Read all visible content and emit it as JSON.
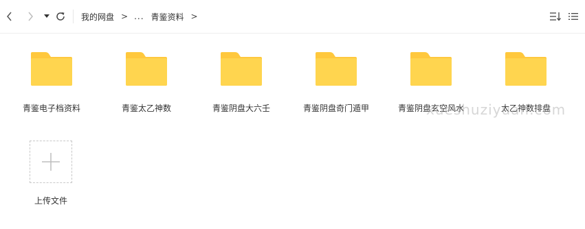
{
  "toolbar": {
    "breadcrumb": {
      "root": "我的网盘",
      "separator": ">",
      "ellipsis": "...",
      "current": "青鉴资料",
      "trailing_separator": ">"
    },
    "icons": {
      "back": "chevron-left-icon",
      "forward": "chevron-right-icon",
      "history": "caret-down-icon",
      "refresh": "refresh-icon",
      "sort": "sort-icon",
      "view": "list-view-icon"
    }
  },
  "files": [
    {
      "name": "青鉴电子档资料",
      "type": "folder"
    },
    {
      "name": "青鉴太乙神数",
      "type": "folder"
    },
    {
      "name": "青鉴阴盘大六壬",
      "type": "folder"
    },
    {
      "name": "青鉴阴盘奇门遁甲",
      "type": "folder"
    },
    {
      "name": "青鉴阴盘玄空风水",
      "type": "folder"
    },
    {
      "name": "太乙神数排盘",
      "type": "folder"
    }
  ],
  "upload": {
    "label": "上传文件"
  },
  "watermark": "xueshuziyuan.com",
  "colors": {
    "folder_body": "#FFD54F",
    "folder_tab": "#FFC83D",
    "accent_text": "#333333",
    "divider": "#EEEEEE"
  }
}
